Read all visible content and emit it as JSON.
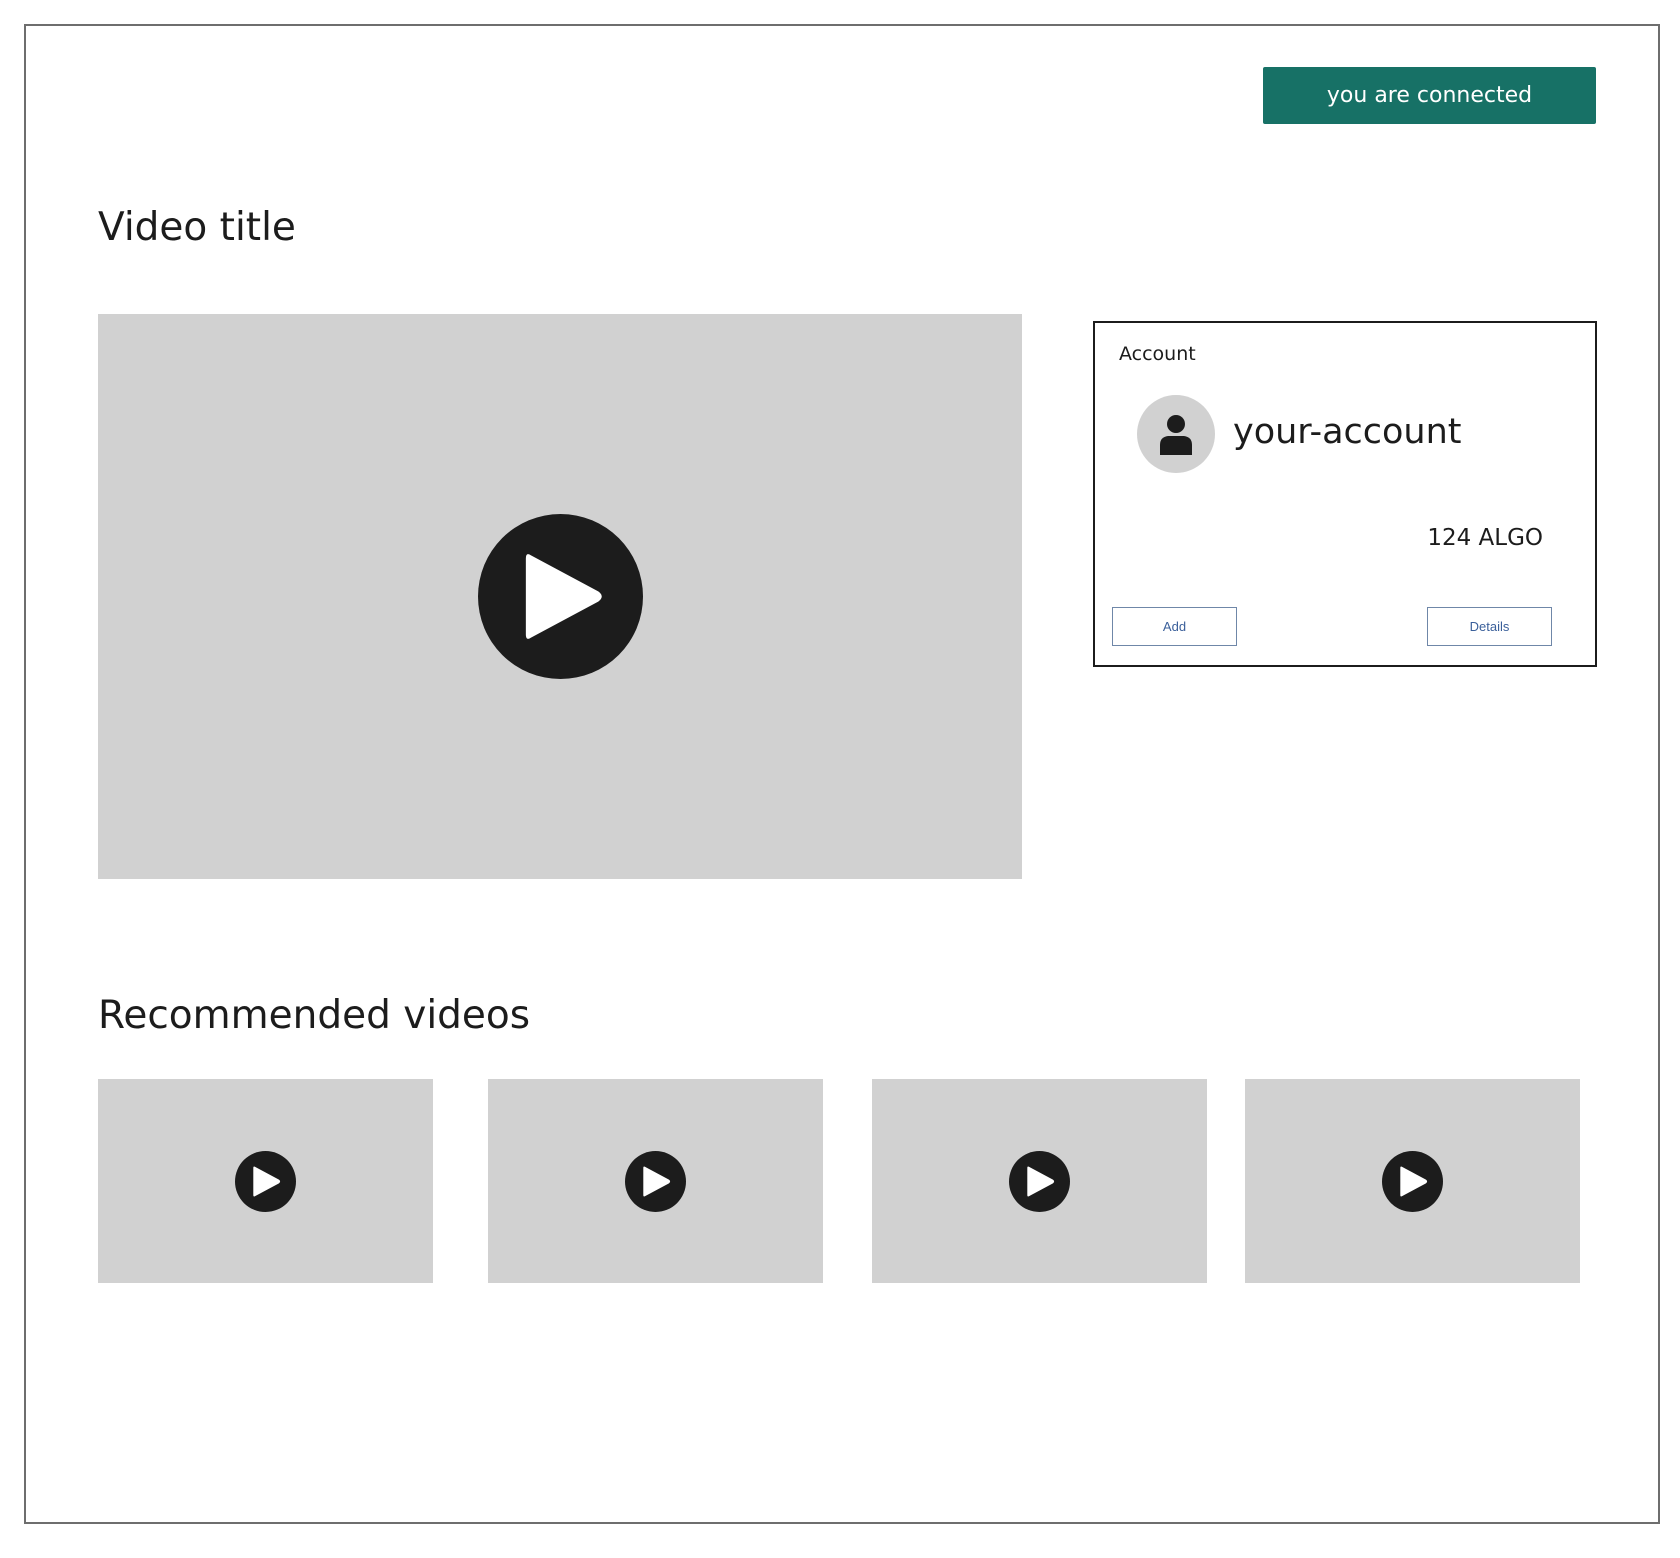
{
  "header": {
    "connection_status": "you are connected",
    "accent_color": "#177166"
  },
  "main": {
    "video_title": "Video title",
    "player_icon": "play-icon"
  },
  "account": {
    "label": "Account",
    "avatar_icon": "user-icon",
    "name": "your-account",
    "balance": "124 ALGO",
    "add_label": "Add",
    "details_label": "Details"
  },
  "recommended": {
    "title": "Recommended videos",
    "thumbnail_icon": "play-icon",
    "count": 4
  }
}
